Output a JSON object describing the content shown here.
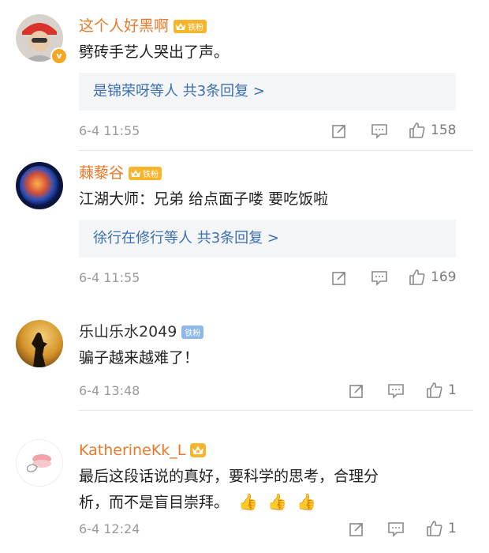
{
  "comments": [
    {
      "username": "这个人好黑啊",
      "fan_label": "铁粉",
      "verified": "v",
      "text": "劈砖手艺人哭出了声。",
      "reply_summary": "是锦荣呀等人  共3条回复 >",
      "time": "6-4 11:55",
      "likes": "158"
    },
    {
      "username": "蕀藜谷",
      "fan_label": "铁粉",
      "text": "江湖大师：兄弟  给点面子喽  要吃饭啦",
      "reply_summary": "徐行在修行等人  共3条回复 >",
      "time": "6-4 11:55",
      "likes": "169"
    },
    {
      "username": "乐山乐水2049",
      "fan_label": "铁粉",
      "text": "骗子越来越难了！",
      "time": "6-4 13:48",
      "likes": "1"
    },
    {
      "username": "KatherineKk_L",
      "text_line1": "最后这段话说的真好，要科学的思考，合理分",
      "text_line2": "析，而不是盲目崇拜。",
      "time": "6-4 12:24",
      "likes": "1"
    }
  ],
  "colors": {
    "orange_name": "#e8792b",
    "link_blue": "#3b6fb0",
    "badge_gold": "#f7b52c",
    "badge_blue": "#8fb8e8"
  },
  "icons": [
    "share-icon",
    "comment-icon",
    "like-icon",
    "thumbs-up-emoji"
  ]
}
